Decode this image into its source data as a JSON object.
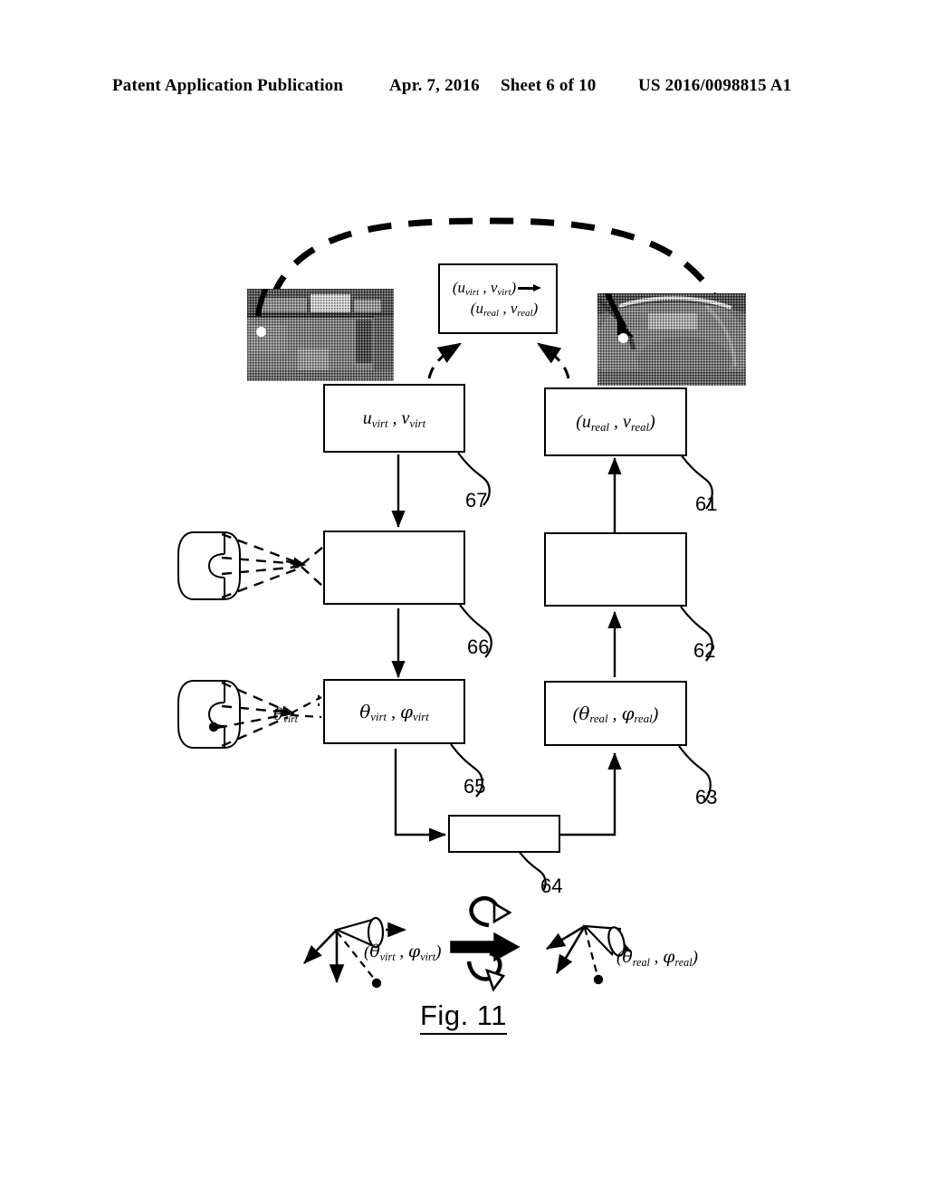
{
  "header": {
    "publication": "Patent Application Publication",
    "date": "Apr. 7, 2016",
    "sheet": "Sheet 6 of 10",
    "number": "US 2016/0098815 A1"
  },
  "figure": {
    "caption": "Fig. 11",
    "conversion_box": {
      "line1": "(u",
      "line1_sub_a": "virt",
      "line1_mid": ", v",
      "line1_sub_b": "virt",
      "line1_end": ")",
      "line2": "(u",
      "line2_sub_a": "real",
      "line2_mid": ", v",
      "line2_sub_b": "real",
      "line2_end": ")",
      "arrow_icon": "right-arrow-icon"
    },
    "boxes": [
      {
        "id": "67",
        "label_html": "u<sub>virt</sub> , v<sub>virt</sub>",
        "ref": "67",
        "column": "left"
      },
      {
        "id": "66",
        "label_html": "",
        "ref": "66",
        "column": "left"
      },
      {
        "id": "65",
        "label_html": "θ<sub>virt</sub> , φ<sub>virt</sub>",
        "ref": "65",
        "column": "left"
      },
      {
        "id": "64",
        "label_html": "",
        "ref": "64",
        "column": "center"
      },
      {
        "id": "63",
        "label_html": "(θ<sub>real</sub> , φ<sub>real</sub>)",
        "ref": "63",
        "column": "right"
      },
      {
        "id": "62",
        "label_html": "",
        "ref": "62",
        "column": "right"
      },
      {
        "id": "61",
        "label_html": "(u<sub>real</sub> , v<sub>real</sub>)",
        "ref": "61",
        "column": "right"
      }
    ],
    "ref_numbers": [
      "67",
      "66",
      "65",
      "64",
      "63",
      "62",
      "61"
    ],
    "angle_label_html": "θ<sub>virt</sub>",
    "coord_label_left_html": "(θ<sub>virt</sub> , φ<sub>virt</sub>)",
    "coord_label_right_html": "(θ<sub>real</sub> , φ<sub>real</sub>)",
    "photos": [
      {
        "name": "virtual-rectilinear-image",
        "marker": "white-dot-marker"
      },
      {
        "name": "real-fisheye-image",
        "marker": "white-dot-marker"
      }
    ],
    "icons": [
      "cylinder-projection-icon",
      "cylinder-projection-angle-icon",
      "camera-axes-virtual-icon",
      "camera-axes-real-icon",
      "rotation-arrow-icon",
      "thick-right-arrow-icon",
      "dashed-correspondence-arc"
    ]
  }
}
